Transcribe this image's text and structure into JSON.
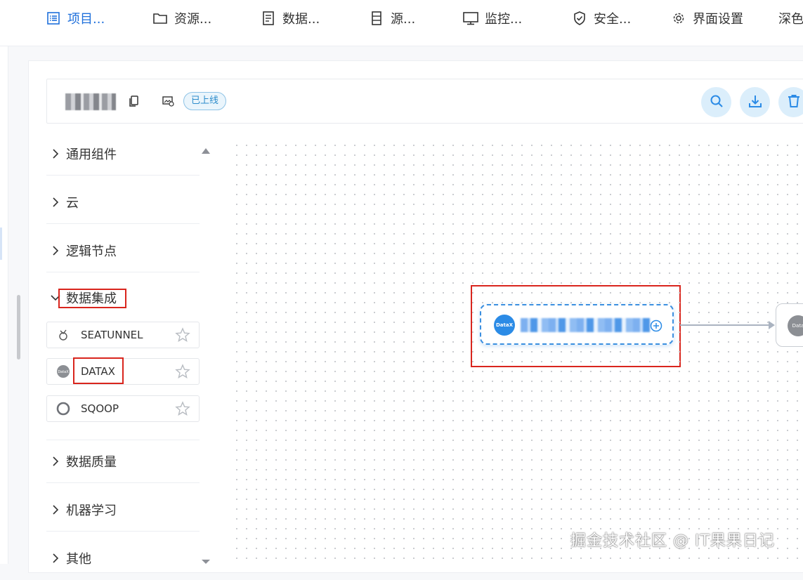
{
  "nav": {
    "items": [
      {
        "label": "项目...",
        "icon": "list-icon",
        "active": true
      },
      {
        "label": "资源...",
        "icon": "folder-icon"
      },
      {
        "label": "数据...",
        "icon": "document-icon"
      },
      {
        "label": "源...",
        "icon": "database-icon"
      },
      {
        "label": "监控...",
        "icon": "monitor-icon"
      },
      {
        "label": "安全...",
        "icon": "shield-icon"
      },
      {
        "label": "界面设置",
        "icon": "gear-icon"
      },
      {
        "label": "深色",
        "icon": ""
      }
    ]
  },
  "toolbar": {
    "status_badge": "已上线",
    "icons": [
      "copy-icon",
      "image-icon",
      "search-icon",
      "download-icon",
      "delete-icon"
    ]
  },
  "sidebar": {
    "groups": [
      {
        "label": "通用组件",
        "expanded": false
      },
      {
        "label": "云",
        "expanded": false
      },
      {
        "label": "逻辑节点",
        "expanded": false
      },
      {
        "label": "数据集成",
        "expanded": true
      },
      {
        "label": "数据质量",
        "expanded": false
      },
      {
        "label": "机器学习",
        "expanded": false
      },
      {
        "label": "其他",
        "expanded": false
      }
    ],
    "components": [
      {
        "label": "SEATUNNEL",
        "icon": "seatunnel-icon"
      },
      {
        "label": "DATAX",
        "icon": "datax-icon"
      },
      {
        "label": "SQOOP",
        "icon": "sqoop-icon"
      }
    ]
  },
  "canvas": {
    "node_logo": "DataX",
    "node2_logo": "Data"
  },
  "watermark": "掘金技术社区 @ IT果果日记",
  "colors": {
    "accent": "#1e6fdb",
    "highlight": "#d9251d",
    "node_border": "#3b8fe0"
  }
}
